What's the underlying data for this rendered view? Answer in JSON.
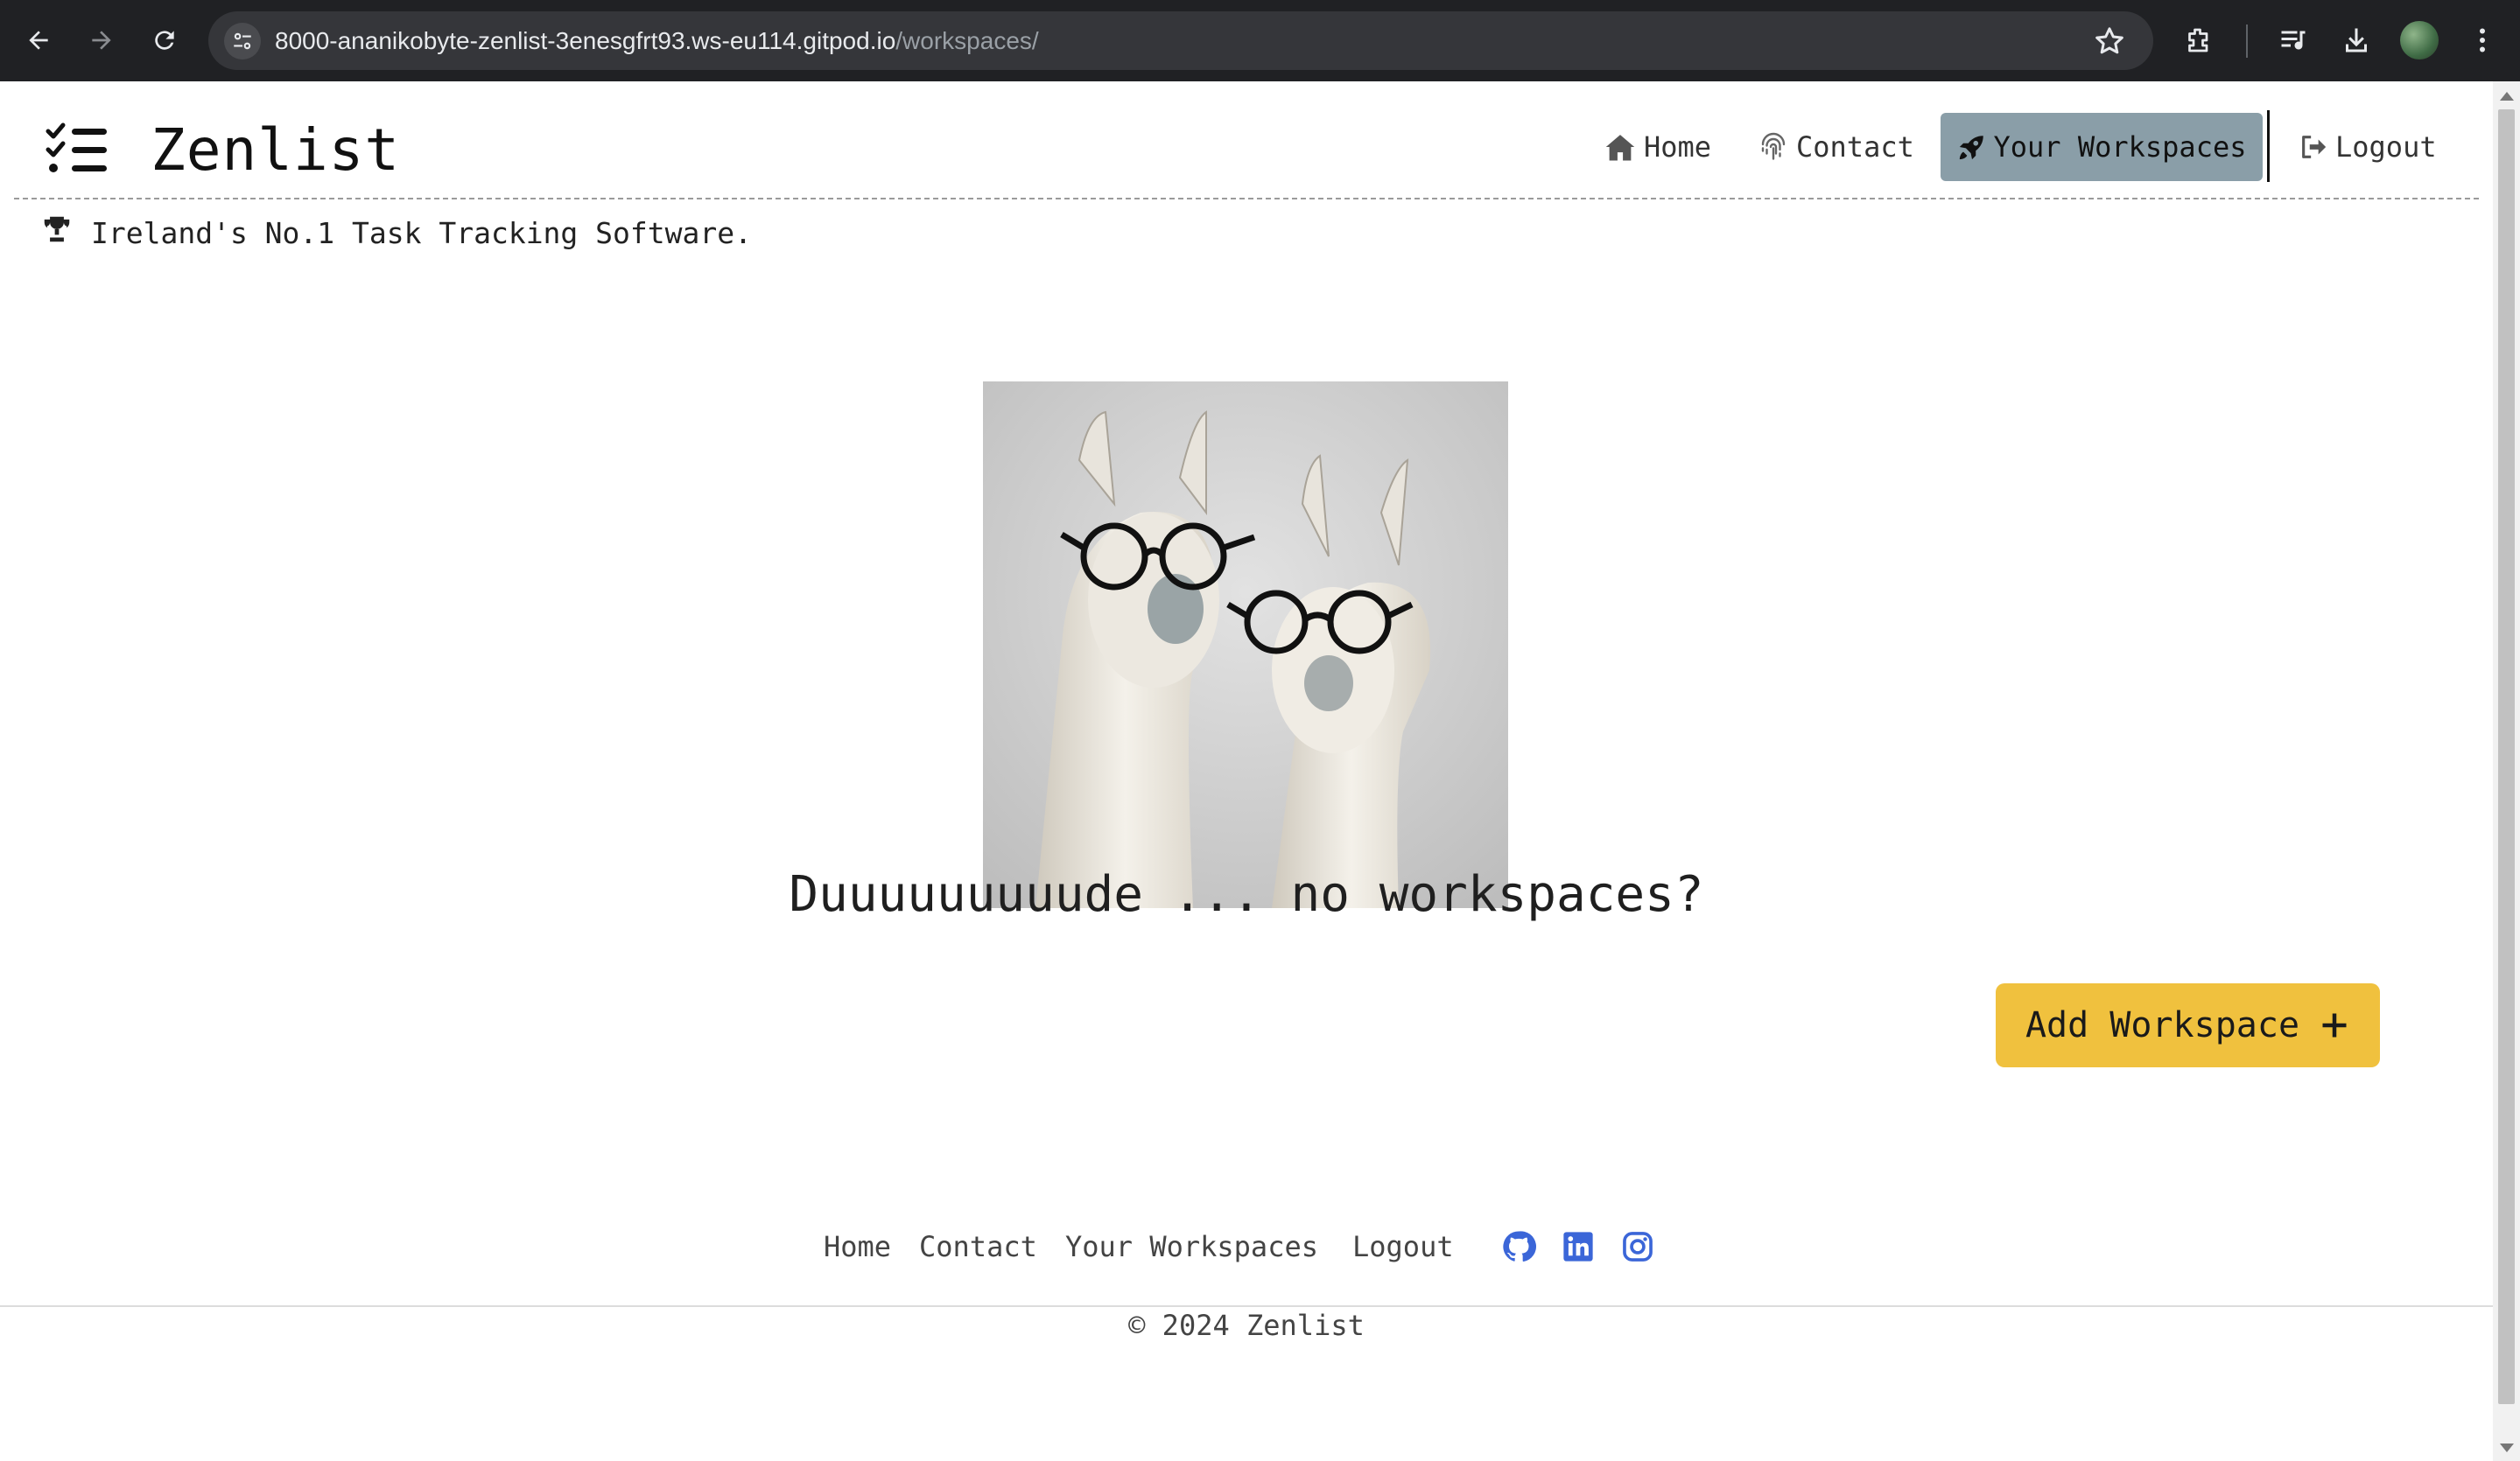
{
  "browser": {
    "url_host": "8000-ananikobyte-zenlist-3enesgfrt93.ws-eu114.gitpod.io",
    "url_path": "/workspaces/"
  },
  "brand": {
    "name": "Zenlist",
    "logo_icon": "list-check-icon"
  },
  "nav": {
    "home": "Home",
    "contact": "Contact",
    "workspaces": "Your Workspaces",
    "logout": "Logout"
  },
  "tagline": "Ireland's No.1 Task Tracking Software.",
  "hero": {
    "image": "llamas-with-glasses"
  },
  "empty_message": "Duuuuuuuuude ... no workspaces?",
  "add_button": "Add Workspace",
  "footer": {
    "links": [
      "Home",
      "Contact",
      "Your Workspaces",
      "Logout"
    ],
    "social": [
      "github-icon",
      "linkedin-icon",
      "instagram-icon"
    ],
    "copyright": "© 2024 Zenlist"
  },
  "colors": {
    "active_nav": "#8a9ea8",
    "add_button": "#f0c13e",
    "social_icons": "#3b66d8"
  }
}
